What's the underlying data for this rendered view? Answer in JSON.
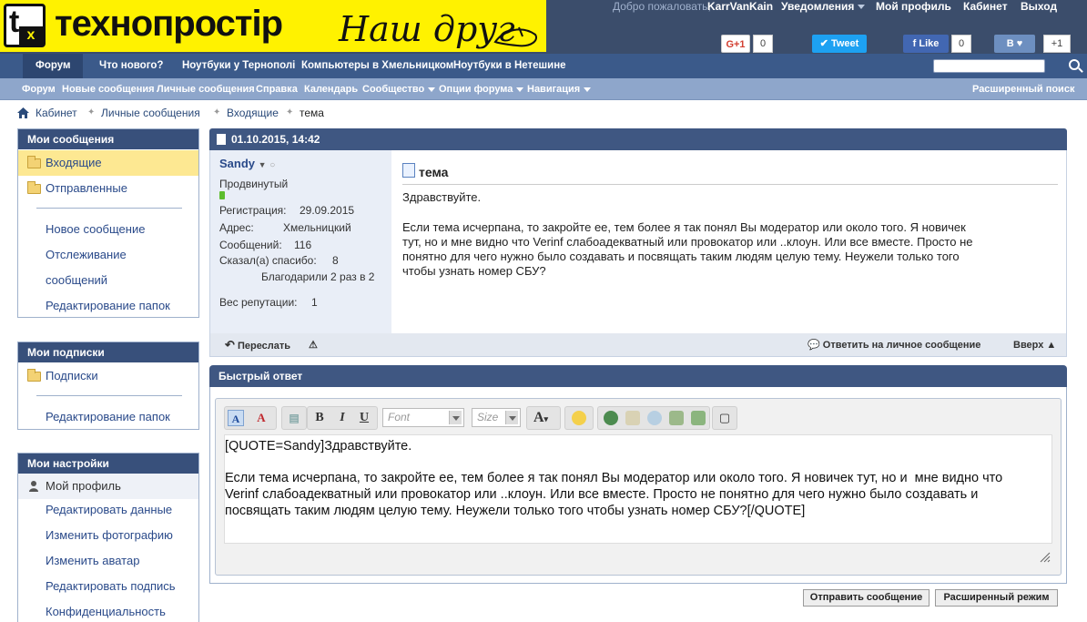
{
  "header": {
    "logo_mark_letter_t": "t",
    "logo_mark_letter_x": "x",
    "logo_text": "технопростір",
    "slogan": "Наш друг",
    "welcome": "Добро пожаловать,",
    "username": "KarrVanKain",
    "links": [
      "Уведомления",
      "Мой профиль",
      "Кабинет",
      "Выход"
    ],
    "social": {
      "gplus": "G+1",
      "gplus_count": "0",
      "tweet": "Tweet",
      "fb_like": "Like",
      "fb_count": "0",
      "vk": "B",
      "vk_count": "+1"
    }
  },
  "nav1": {
    "items": [
      "Форум",
      "Что нового?",
      "Ноутбуки у Тернополі",
      "Компьютеры в Хмельницком",
      "Ноутбуки в Нетешине"
    ]
  },
  "nav2": {
    "items": [
      "Форум",
      "Новые сообщения",
      "Личные сообщения",
      "Справка",
      "Календарь",
      "Сообщество",
      "Опции форума",
      "Навигация"
    ],
    "advanced_search": "Расширенный поиск"
  },
  "breadcrumb": [
    "Кабинет",
    "Личные сообщения",
    "Входящие",
    "тема"
  ],
  "sidebar": {
    "my_messages": {
      "title": "Мои сообщения",
      "folders": [
        "Входящие",
        "Отправленные"
      ],
      "links": [
        "Новое сообщение",
        "Отслеживание",
        "сообщений",
        "Редактирование папок"
      ]
    },
    "my_subscriptions": {
      "title": "Мои подписки",
      "folders": [
        "Подписки"
      ],
      "links": [
        "Редактирование папок"
      ]
    },
    "my_settings": {
      "title": "Мои настройки",
      "profile": "Мой профиль",
      "links": [
        "Редактировать данные",
        "Изменить фотографию",
        "Изменить аватар",
        "Редактировать подпись",
        "Конфиденциальность"
      ]
    }
  },
  "message": {
    "date": "01.10.2015, 14:42",
    "user": {
      "name": "Sandy",
      "rank": "Продвинутый",
      "registration_label": "Регистрация:",
      "registration": "29.09.2015",
      "address_label": "Адрес:",
      "address": "Хмельницкий",
      "posts_label": "Сообщений:",
      "posts": "116",
      "thanks_label": "Сказал(а) спасибо:",
      "thanks": "8",
      "thanked": "Благодарили 2 раз в 2",
      "reputation_label": "Вес репутации:",
      "reputation": "1"
    },
    "title": "тема",
    "greeting": "Здравствуйте.",
    "body_lines": [
      "Если тема исчерпана, то закройте ее, тем более я так понял Вы модератор или около того. Я новичек",
      "тут, но и мне видно что Verinf слабоадекватный или провокатор или ..клоун. Или все вместе. Просто не",
      "понятно для чего нужно было создавать и посвящать таким людям целую тему. Неужели только того",
      "чтобы узнать номер СБУ?"
    ],
    "forward": "Переслать",
    "reply": "Ответить на личное сообщение",
    "top": "Вверх ▲"
  },
  "quick_reply": {
    "title": "Быстрый ответ",
    "font_placeholder": "Font",
    "size_placeholder": "Size",
    "text_lines": [
      "[QUOTE=Sandy]Здравствуйте.",
      "",
      "Если тема исчерпана, то закройте ее, тем более я так понял Вы модератор или около того. Я новичек тут, но и  мне видно что",
      "Verinf слабоадекватный или провокатор или ..клоун. Или все вместе. Просто не понятно для чего нужно было создавать и",
      "посвящать таким людям целую тему. Неужели только того чтобы узнать номер СБУ?[/QUOTE]"
    ],
    "send": "Отправить сообщение",
    "advanced": "Расширенный режим"
  },
  "colors": {
    "header_bg": "#3b4d6b",
    "logo_bg": "#fff200",
    "nav1_bg": "#3b5a8a",
    "nav2_bg": "#8ea6cb",
    "panel_head": "#38507b",
    "selected": "#fde892",
    "link": "#2a4a8a"
  }
}
